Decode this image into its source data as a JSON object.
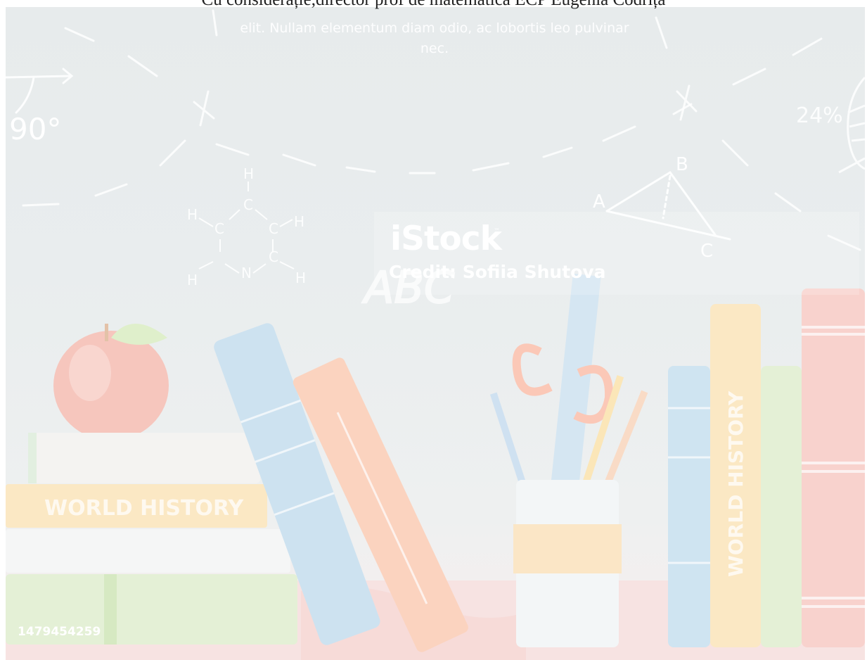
{
  "header": {
    "caption": "Cu considerație,director prof de matematică ECP Eugenia Codrița"
  },
  "chalkboard": {
    "placeholder_text": "elit. Nullam elementum diam odio, ac lobortis leo pulvinar nec.",
    "angle_label": "90°",
    "percent_label": "24%",
    "triangle_vertices": [
      "A",
      "B",
      "C"
    ],
    "molecule_atoms": [
      "H",
      "C",
      "C",
      "H",
      "C",
      "C",
      "H",
      "H",
      "N",
      "H"
    ],
    "letters_doodle": "ABC"
  },
  "watermark": {
    "brand": "iStock",
    "tm": "™",
    "credit": "Credit: Sofiia Shutova",
    "stock_id": "1479454259"
  },
  "books": {
    "left_stack_spine": "WORLD HISTORY",
    "right_row_spine": "WORLD HISTORY"
  },
  "colors": {
    "chalkboard": "#e8ecee",
    "chalk": "#ffffff",
    "apple": "#f7c9c0",
    "book_blue": "#cfe3f1",
    "book_orange": "#fbd7c2",
    "book_yellow": "#fbeccd",
    "book_green": "#e2f0d7",
    "book_red": "#f8d3cf",
    "shelf": "#f7e0df"
  }
}
